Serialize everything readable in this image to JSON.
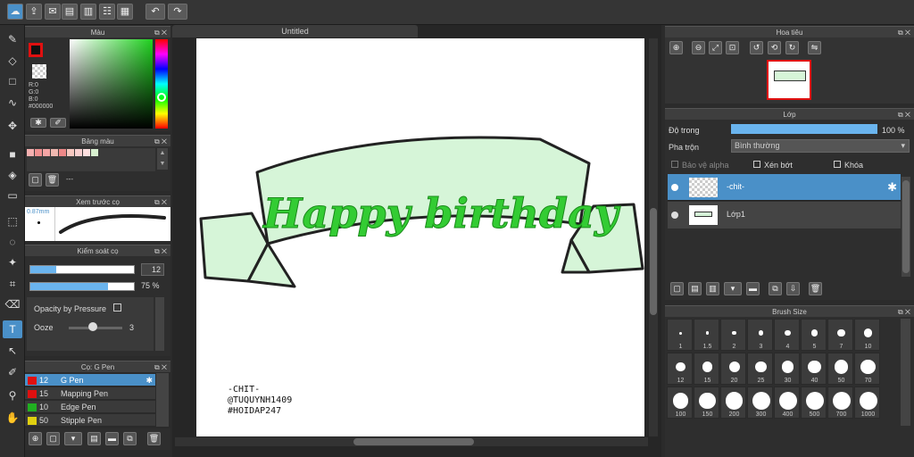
{
  "colors": {
    "accent": "#4a90c8",
    "banner_fill": "#d6f5d8",
    "lettering": "#33cc33",
    "primary_color": "#e01010"
  },
  "color_panel": {
    "title": "Màu",
    "rgb": {
      "r": "R:0",
      "g": "G:0",
      "b": "B:0"
    },
    "hex": "#000000"
  },
  "palette_panel": {
    "title": "Bảng màu",
    "item_label": "---"
  },
  "preview_panel": {
    "title": "Xem trước cọ",
    "size": "0.87mm"
  },
  "brush_control": {
    "title": "Kiểm soát cọ",
    "size_value": "12",
    "opacity_value": "75",
    "opacity_unit": "%",
    "pressure_label": "Opacity by Pressure",
    "ooze_label": "Ooze",
    "ooze_value": "3",
    "size_fraction": 0.25,
    "opacity_fraction": 0.75,
    "ooze_fraction": 0.45
  },
  "brush_panel": {
    "title": "Cọ: G Pen",
    "items": [
      {
        "size": "12",
        "name": "G Pen",
        "color": "#e01010"
      },
      {
        "size": "15",
        "name": "Mapping Pen",
        "color": "#e01010"
      },
      {
        "size": "10",
        "name": "Edge Pen",
        "color": "#20b020"
      },
      {
        "size": "50",
        "name": "Stipple Pen",
        "color": "#e0d010"
      }
    ]
  },
  "canvas": {
    "tab": "Untitled",
    "lettering": "Happy birthday",
    "watermark": [
      "-CHIT-",
      "@TUQUYNH1409",
      "#HOIDAP247"
    ]
  },
  "navigator": {
    "title": "Hoa tiêu"
  },
  "layer_panel": {
    "title": "Lớp",
    "opacity_label": "Độ trong",
    "opacity_value": "100",
    "opacity_unit": "%",
    "opacity_fraction": 1.0,
    "blend_label": "Pha trộn",
    "blend_value": "Bình thường",
    "protect_alpha": "Bảo vệ alpha",
    "clipping": "Xén bớt",
    "lock": "Khóa",
    "layers": [
      "-chit-",
      "Lớp1"
    ]
  },
  "brush_size_panel": {
    "title": "Brush Size",
    "sizes": [
      "1",
      "1.5",
      "2",
      "3",
      "4",
      "5",
      "7",
      "10",
      "12",
      "15",
      "20",
      "25",
      "30",
      "40",
      "50",
      "70",
      "100",
      "150",
      "200",
      "300",
      "400",
      "500",
      "700",
      "1000"
    ]
  }
}
